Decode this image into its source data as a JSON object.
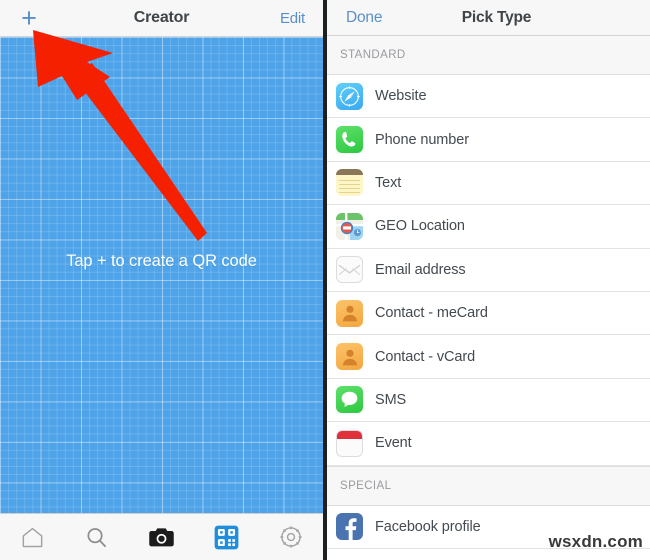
{
  "left": {
    "navbar": {
      "add_label": "+",
      "title": "Creator",
      "edit_label": "Edit"
    },
    "canvas": {
      "hint": "Tap + to create a QR code",
      "background_color": "#4ea3e9",
      "grid_color": "#ffffff"
    },
    "tabbar": {
      "items": [
        {
          "icon": "home-icon",
          "selected": false
        },
        {
          "icon": "search-icon",
          "selected": false
        },
        {
          "icon": "camera-icon",
          "selected": false
        },
        {
          "icon": "qr-code-icon",
          "selected": true
        },
        {
          "icon": "gear-icon",
          "selected": false
        }
      ]
    },
    "annotation": {
      "icon": "red-arrow-annotation",
      "color": "#f42000",
      "points_to": "add-button"
    }
  },
  "right": {
    "navbar": {
      "done_label": "Done",
      "title": "Pick Type"
    },
    "sections": [
      {
        "header": "STANDARD",
        "items": [
          {
            "label": "Website",
            "icon": "safari-compass-icon"
          },
          {
            "label": "Phone number",
            "icon": "phone-handset-icon"
          },
          {
            "label": "Text",
            "icon": "notes-icon"
          },
          {
            "label": "GEO Location",
            "icon": "maps-icon"
          },
          {
            "label": "Email address",
            "icon": "mail-envelope-icon"
          },
          {
            "label": "Contact - meCard",
            "icon": "contacts-person-icon"
          },
          {
            "label": "Contact - vCard",
            "icon": "contacts-person-icon"
          },
          {
            "label": "SMS",
            "icon": "sms-bubble-icon"
          },
          {
            "label": "Event",
            "icon": "calendar-icon"
          }
        ]
      },
      {
        "header": "SPECIAL",
        "items": [
          {
            "label": "Facebook profile",
            "icon": "facebook-icon"
          }
        ]
      }
    ]
  },
  "watermark": "wsxdn.com",
  "colors": {
    "accent_blue": "#5b8fc9",
    "canvas_blue": "#4ea3e9",
    "arrow_red": "#f42000",
    "tab_selected": "#1f8fdd"
  }
}
